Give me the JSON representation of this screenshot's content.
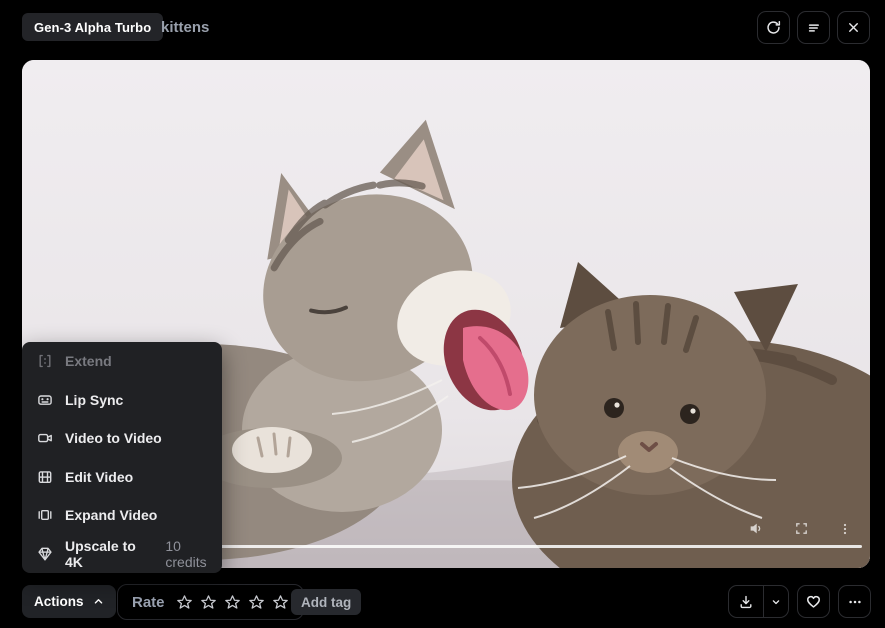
{
  "header": {
    "model_badge": "Gen-3 Alpha Turbo",
    "session_title": "kittens",
    "buttons": [
      {
        "name": "rerun",
        "icon": "refresh-icon"
      },
      {
        "name": "session-details",
        "icon": "list-icon"
      },
      {
        "name": "close",
        "icon": "close-icon"
      }
    ]
  },
  "video": {
    "alt": "Two tabby kittens lying on a gray cushion; the lighter kitten on the left yawns widely with its pink tongue out while the darker brown kitten on the right looks down.",
    "player": {
      "muted_volume_icon": "volume-icon",
      "fullscreen_icon": "fullscreen-icon",
      "more_icon": "kebab-icon",
      "progress_percent": 100
    }
  },
  "actions_menu": {
    "items": [
      {
        "label": "Extend",
        "icon": "extend-icon",
        "disabled": true
      },
      {
        "label": "Lip Sync",
        "icon": "lip-sync-icon",
        "disabled": false
      },
      {
        "label": "Video to Video",
        "icon": "video-to-video-icon",
        "disabled": false
      },
      {
        "label": "Edit Video",
        "icon": "edit-video-icon",
        "disabled": false
      },
      {
        "label": "Expand Video",
        "icon": "expand-video-icon",
        "disabled": false
      },
      {
        "label": "Upscale to 4K",
        "icon": "upscale-icon",
        "disabled": false,
        "suffix": "10 credits"
      }
    ]
  },
  "footer": {
    "actions_button": "Actions",
    "rate_label": "Rate",
    "stars_total": 5,
    "stars_filled": 0,
    "add_tag_button": "Add tag",
    "right_buttons": [
      "download",
      "download-options",
      "favorite",
      "more-options"
    ]
  },
  "colors": {
    "page_bg": "#000000",
    "menu_bg": "#202124",
    "video_bg": "#eae6e9",
    "text_primary": "#ececee",
    "text_muted": "#8f919a",
    "title_color": "#99a0ac",
    "tongue_pink": "#e56e8d"
  }
}
